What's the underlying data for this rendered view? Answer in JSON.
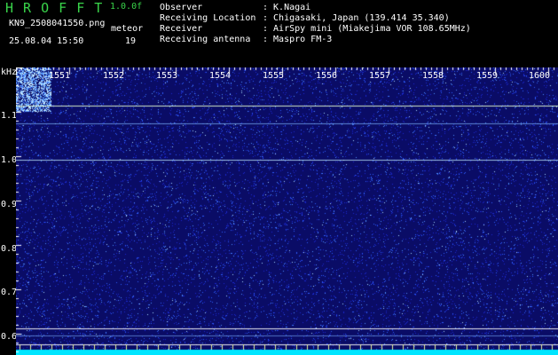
{
  "app": {
    "title": "H R O F F T",
    "version": "1.0.0f",
    "filename": "KN9_2508041550.png",
    "mode": "meteor",
    "datetime": "25.08.04 15:50",
    "count": "19"
  },
  "info": [
    {
      "label": "Observer",
      "value": ": K.Nagai"
    },
    {
      "label": "Receiving Location",
      "value": ": Chigasaki, Japan (139.414 35.340)"
    },
    {
      "label": "Receiver",
      "value": ": AirSpy mini (Miakejima VOR 108.65MHz)"
    },
    {
      "label": "Receiving antenna",
      "value": ": Maspro FM-3"
    }
  ],
  "axis": {
    "y_unit": "kHz",
    "y_ticks": [
      "1.1",
      "1.0",
      "0.9",
      "0.8",
      "0.7",
      "0.6"
    ],
    "x_ticks": [
      "1551",
      "1552",
      "1553",
      "1554",
      "1555",
      "1556",
      "1557",
      "1558",
      "1559",
      "1600"
    ]
  },
  "colors": {
    "background": "#0a0c66",
    "noise": "#2a4cff",
    "signal": "#9fe6ff",
    "baseline": "#00e5ff",
    "title": "#39d44a"
  }
}
